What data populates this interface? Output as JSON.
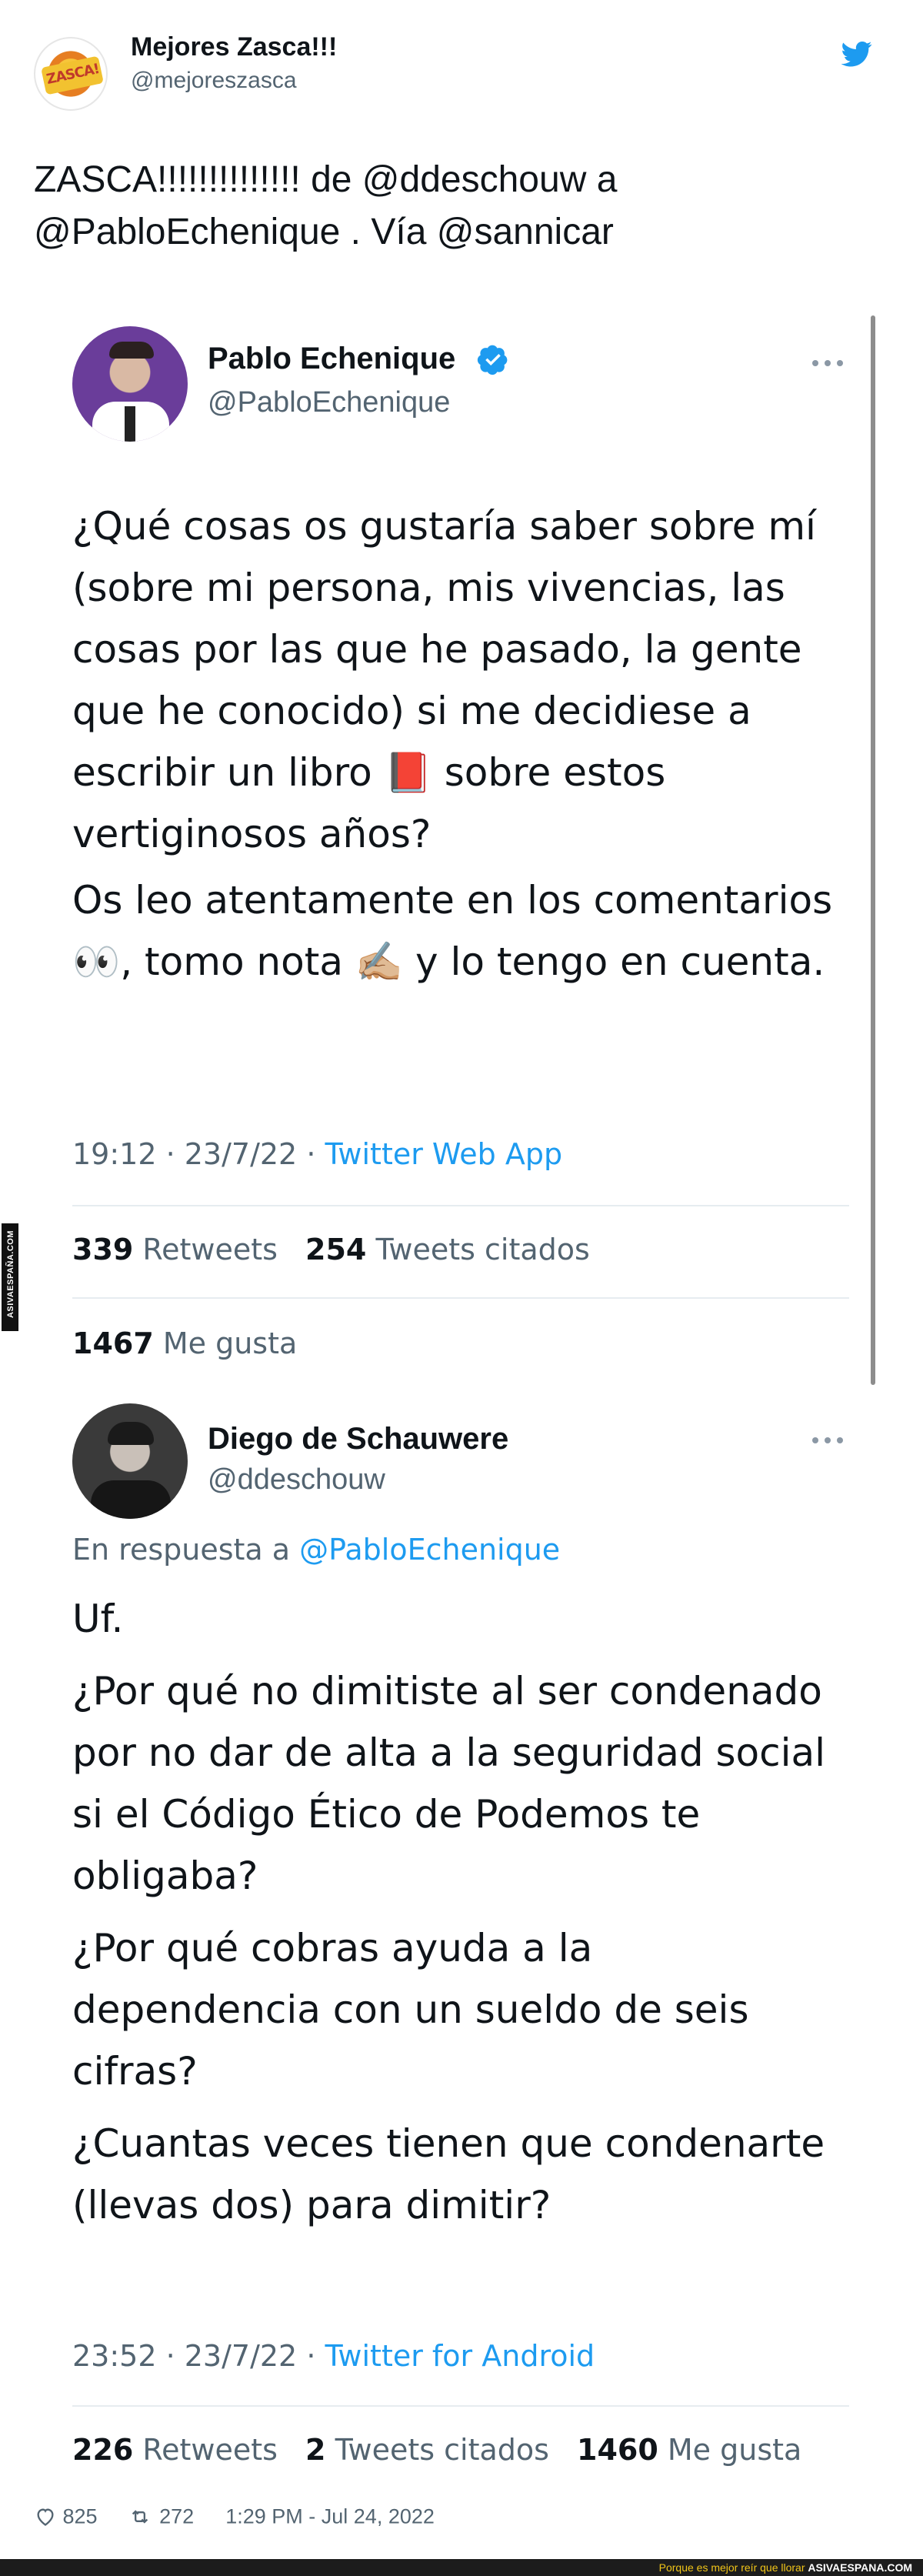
{
  "outer_tweet": {
    "author_name": "Mejores Zasca!!!",
    "author_handle": "@mejoreszasca",
    "avatar_text": "ZASCA!",
    "text": "ZASCA!!!!!!!!!!!!!! de @ddeschouw a @PabloEchenique . Vía @sannicar",
    "likes": "825",
    "retweets": "272",
    "timestamp": "1:29 PM - Jul 24, 2022"
  },
  "quoted_tweet_1": {
    "author_name": "Pablo Echenique",
    "author_handle": "@PabloEchenique",
    "verified": true,
    "paragraphs": [
      "¿Qué cosas os gustaría saber sobre mí (sobre mi persona, mis vivencias, las cosas por las que he pasado, la gente que he conocido) si me decidiese a escribir un libro 📕 sobre estos vertiginosos años?",
      "Os leo atentamente en los comentarios 👀, tomo nota ✍🏼 y lo tengo en cuenta."
    ],
    "time": "19:12 · 23/7/22 · ",
    "app": "Twitter Web App",
    "retweets": "339",
    "retweets_label": "Retweets",
    "quotes": "254",
    "quotes_label": "Tweets citados",
    "likes": "1467",
    "likes_label": "Me gusta"
  },
  "quoted_tweet_2": {
    "author_name": "Diego de Schauwere",
    "author_handle": "@ddeschouw",
    "reply_prefix": "En respuesta a ",
    "reply_mention": "@PabloEchenique",
    "paragraphs": [
      "Uf.",
      "¿Por qué no dimitiste al ser condenado por no dar de alta a la seguridad social si el Código Ético de Podemos te obligaba?",
      "¿Por qué cobras ayuda a la dependencia con un sueldo de seis cifras?",
      "¿Cuantas veces tienen que condenarte (llevas dos) para dimitir?"
    ],
    "time": "23:52 · 23/7/22 · ",
    "app": "Twitter for Android",
    "retweets": "226",
    "retweets_label": "Retweets",
    "quotes": "2",
    "quotes_label": "Tweets citados",
    "likes": "1460",
    "likes_label": "Me gusta"
  },
  "watermark": {
    "side": "ASIVAESPAÑA.COM",
    "bottom_caption": "Porque es mejor reír que llorar",
    "bottom_site": "ASIVAESPANA.COM"
  },
  "colors": {
    "link_blue": "#1d9bf0",
    "secondary_gray": "#536471",
    "text_dark": "#0f1419",
    "verified_blue": "#1d9bf0"
  },
  "icons": [
    "twitter-bird-icon",
    "verified-badge-icon",
    "more-options-icon",
    "heart-icon",
    "retweet-icon"
  ]
}
